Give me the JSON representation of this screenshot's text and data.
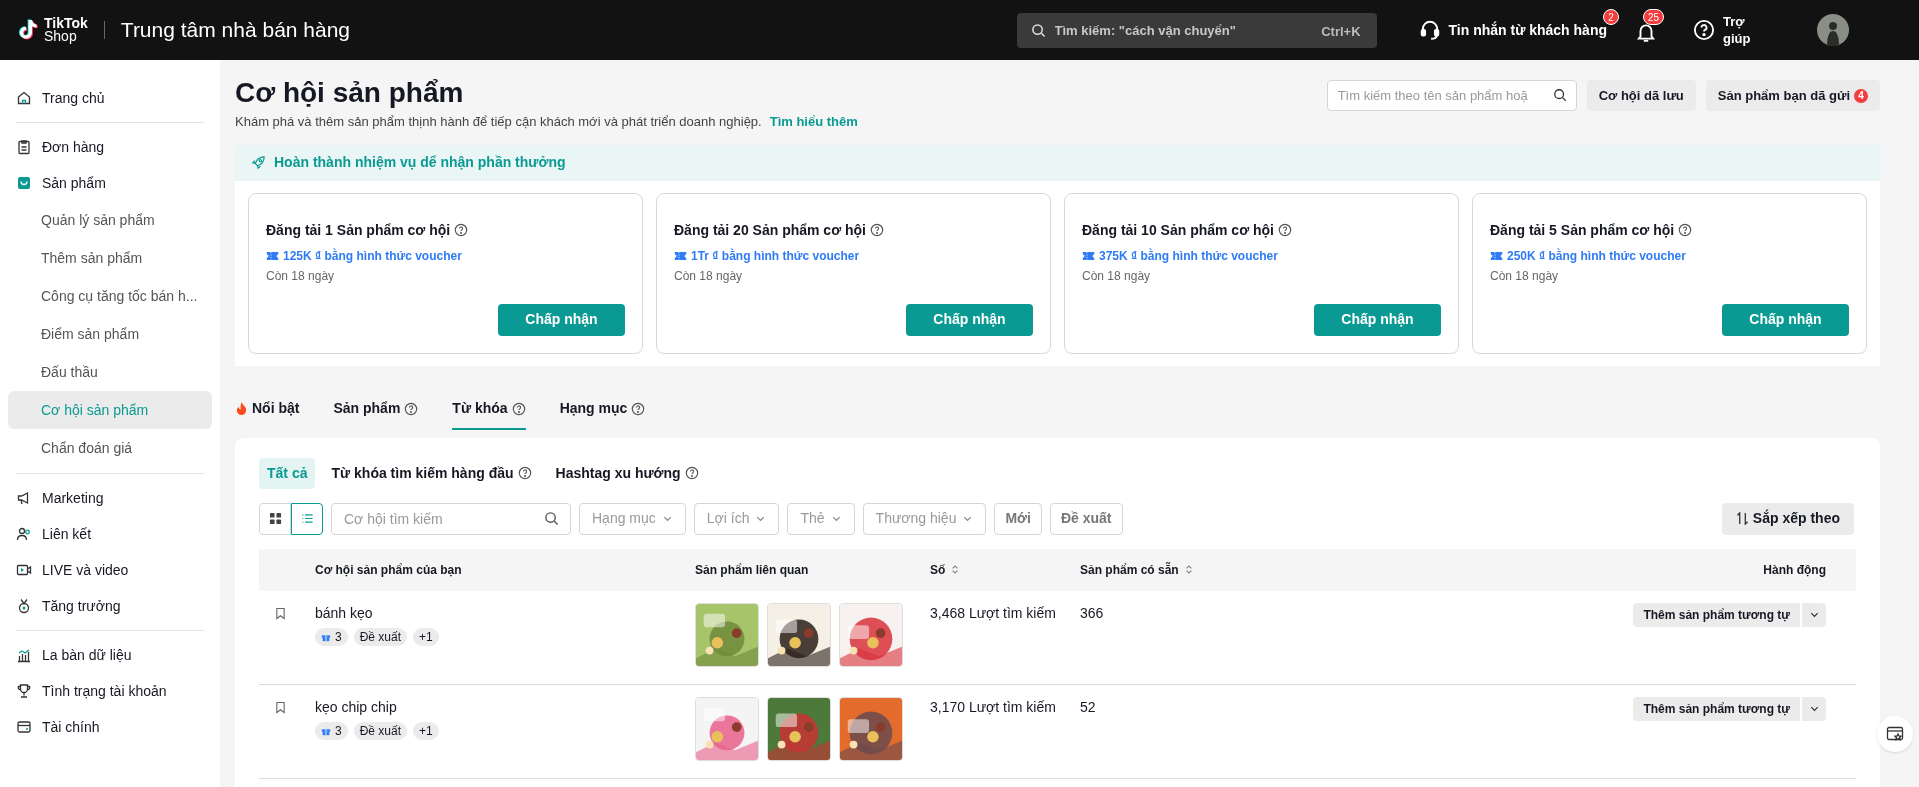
{
  "header": {
    "logo_top": "TikTok",
    "logo_bottom": "Shop",
    "title": "Trung tâm nhà bán hàng",
    "search": {
      "placeholder": "Tìm kiếm: \"cách vận chuyển\"",
      "shortcut": "Ctrl+K"
    },
    "messages": {
      "label": "Tin nhắn từ khách hàng",
      "badge": "2"
    },
    "notifications": {
      "badge": "25"
    },
    "help": "Trợ giúp"
  },
  "sidebar": {
    "sections": [
      [
        {
          "label": "Trang chủ",
          "selected": false
        }
      ],
      [
        {
          "label": "Đơn hàng",
          "selected": false
        },
        {
          "label": "Sản phẩm",
          "selected": false,
          "children": [
            {
              "label": "Quản lý sản phẩm",
              "selected": false
            },
            {
              "label": "Thêm sản phẩm",
              "selected": false
            },
            {
              "label": "Công cụ tăng tốc bán h...",
              "selected": false
            },
            {
              "label": "Điểm sản phẩm",
              "selected": false
            },
            {
              "label": "Đấu thầu",
              "selected": false
            },
            {
              "label": "Cơ hội sản phẩm",
              "selected": true
            },
            {
              "label": "Chẩn đoán giá",
              "selected": false
            }
          ]
        }
      ],
      [
        {
          "label": "Marketing",
          "selected": false
        },
        {
          "label": "Liên kết",
          "selected": false
        },
        {
          "label": "LIVE và video",
          "selected": false
        },
        {
          "label": "Tăng trưởng",
          "selected": false
        }
      ],
      [
        {
          "label": "La bàn dữ liệu",
          "selected": false
        },
        {
          "label": "Tình trạng tài khoản",
          "selected": false
        },
        {
          "label": "Tài chính",
          "selected": false
        }
      ]
    ]
  },
  "page": {
    "title": "Cơ hội sản phẩm",
    "description": "Khám phá và thêm sản phẩm thịnh hành để tiếp cận khách mới và phát triển doanh nghiệp.",
    "learn_more": "Tìm hiểu thêm",
    "search": {
      "placeholder": "Tìm kiếm theo tên sản phẩm hoặ"
    },
    "saved_button": "Cơ hội dã lưu",
    "submitted_button": {
      "label": "Sản phẩm bạn dã gửi",
      "badge": "4"
    }
  },
  "quest": {
    "title": "Hoàn thành nhiệm vụ dể nhận phần thưởng",
    "cards": [
      {
        "title": "Đăng tải 1 Sản phẩm cơ hội",
        "reward": "125K ₫ bằng hình thức voucher",
        "remaining": "Còn 18 ngày",
        "button": "Chấp nhận"
      },
      {
        "title": "Đăng tải 20 Sản phẩm cơ hội",
        "reward": "1Tr ₫ bằng hình thức voucher",
        "remaining": "Còn 18 ngày",
        "button": "Chấp nhận"
      },
      {
        "title": "Đăng tải 10 Sản phẩm cơ hội",
        "reward": "375K ₫ bằng hình thức voucher",
        "remaining": "Còn 18 ngày",
        "button": "Chấp nhận"
      },
      {
        "title": "Đăng tải 5 Sản phẩm cơ hội",
        "reward": "250K ₫ bằng hình thức voucher",
        "remaining": "Còn 18 ngày",
        "button": "Chấp nhận"
      }
    ]
  },
  "tabs": [
    {
      "label": "Nổi bật",
      "kind": "featured",
      "selected": false
    },
    {
      "label": "Sản phẩm",
      "kind": "help",
      "selected": false
    },
    {
      "label": "Từ khóa",
      "kind": "help",
      "selected": true
    },
    {
      "label": "Hạng mục",
      "kind": "help",
      "selected": false
    }
  ],
  "subtabs": [
    {
      "label": "Tất cả",
      "kind": "plain",
      "selected": true
    },
    {
      "label": "Từ khóa tìm kiếm hàng đầu",
      "kind": "help",
      "selected": false
    },
    {
      "label": "Hashtag xu hướng",
      "kind": "help",
      "selected": false
    }
  ],
  "toolbar": {
    "views": [
      {
        "kind": "grid",
        "selected": false
      },
      {
        "kind": "list",
        "selected": true
      }
    ],
    "search": {
      "placeholder": "Cơ hội tìm kiếm"
    },
    "dropdowns": [
      "Hạng mục",
      "Lợi ích",
      "Thẻ",
      "Thương hiệu"
    ],
    "buttons": [
      "Mới",
      "Đề xuất"
    ],
    "sort": "Sắp xếp theo"
  },
  "table": {
    "columns": [
      {
        "label": "Cơ hội sản phẩm của bạn",
        "sortable": false
      },
      {
        "label": "Sản phẩm liên quan",
        "sortable": false
      },
      {
        "label": "Số",
        "sortable": true
      },
      {
        "label": "Sản phẩm có sẵn",
        "sortable": true
      },
      {
        "label": "Hành động",
        "sortable": false
      }
    ],
    "rows": [
      {
        "name": "bánh kẹo",
        "tags": [
          {
            "kind": "gift",
            "label": "3"
          },
          {
            "kind": "text",
            "label": "Đề xuất"
          },
          {
            "kind": "text",
            "label": "+1"
          }
        ],
        "images": [
          {
            "kind": "picture"
          },
          {
            "kind": "picture"
          },
          {
            "kind": "picture"
          }
        ],
        "searches": "3,468 Lượt tìm kiếm",
        "available": "366",
        "action": "Thêm sản phẩm tương tự"
      },
      {
        "name": "kẹo chip chip",
        "tags": [
          {
            "kind": "gift",
            "label": "3"
          },
          {
            "kind": "text",
            "label": "Đề xuất"
          },
          {
            "kind": "text",
            "label": "+1"
          }
        ],
        "images": [
          {
            "kind": "picture"
          },
          {
            "kind": "picture"
          },
          {
            "kind": "picture"
          }
        ],
        "searches": "3,170 Lượt tìm kiếm",
        "available": "52",
        "action": "Thêm sản phẩm tương tự"
      }
    ]
  }
}
